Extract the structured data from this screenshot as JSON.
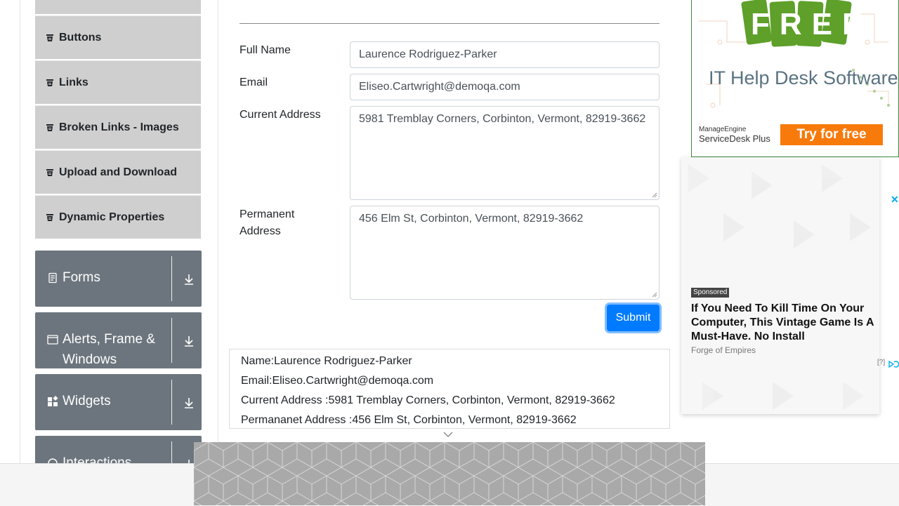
{
  "sidebar": {
    "items": [
      {
        "label": "Buttons"
      },
      {
        "label": "Links"
      },
      {
        "label": "Broken Links - Images"
      },
      {
        "label": "Upload and Download"
      },
      {
        "label": "Dynamic Properties"
      }
    ],
    "groups": [
      {
        "label": "Forms",
        "icon": "document-icon"
      },
      {
        "label": "Alerts, Frame & Windows",
        "icon": "window-icon"
      },
      {
        "label": "Widgets",
        "icon": "widgets-icon"
      },
      {
        "label": "Interactions",
        "icon": "interactions-icon"
      }
    ]
  },
  "form": {
    "full_name_label": "Full Name",
    "full_name_value": "Laurence Rodriguez-Parker",
    "email_label": "Email",
    "email_value": "Eliseo.Cartwright@demoqa.com",
    "current_address_label": "Current Address",
    "current_address_value": "5981 Tremblay Corners, Corbinton, Vermont, 82919-3662",
    "permanent_address_label": "Permanent Address",
    "permanent_address_value": "456 Elm St, Corbinton, Vermont, 82919-3662",
    "submit_label": "Submit"
  },
  "output": {
    "name": "Name:Laurence Rodriguez-Parker",
    "email": "Email:Eliseo.Cartwright@demoqa.com",
    "current_address": "Current Address :5981 Tremblay Corners, Corbinton, Vermont, 82919-3662",
    "permanent_address": "Permananet Address :456 Elm St, Corbinton, Vermont, 82919-3662"
  },
  "ads": {
    "top_badge": "FREE",
    "top_title": "IT Help Desk Software",
    "top_brand_1": "ManageEngine",
    "top_brand_2": "ServiceDesk Plus",
    "top_cta": "Try for free",
    "close": "✕",
    "sponsored": "Sponsored",
    "headline": "If You Need To Kill Time On Your Computer, This Vintage Game Is A Must-Have. No Install",
    "source": "Forge of Empires",
    "info": "[?]"
  },
  "colors": {
    "accent": "#007bff",
    "group_bg": "#6c757d",
    "item_bg": "#cfcfcf"
  }
}
